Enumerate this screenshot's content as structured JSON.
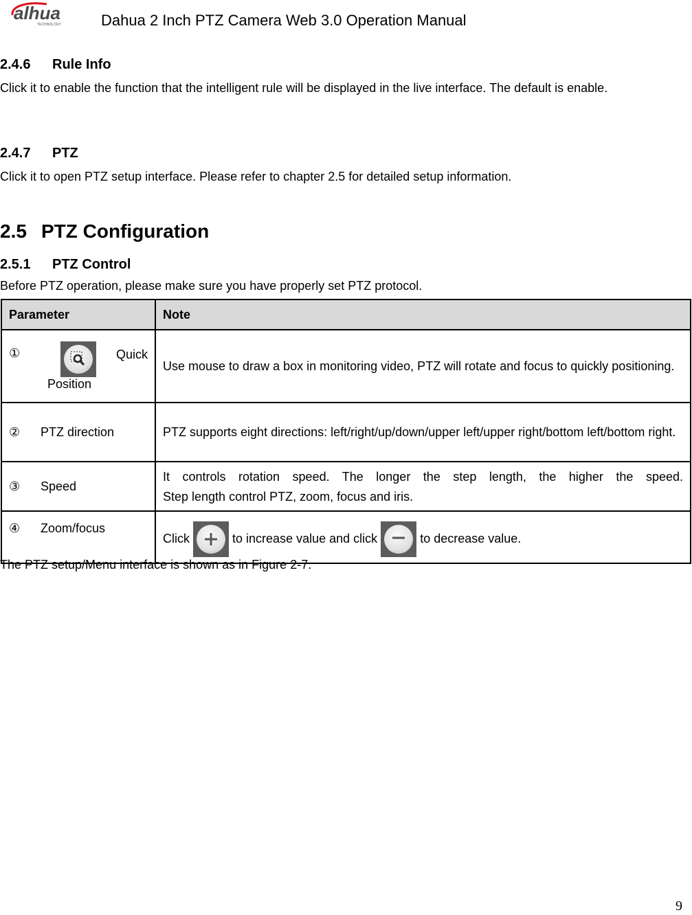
{
  "header": {
    "logo_text": "alhua",
    "logo_subtext": "TECHNOLOGY",
    "title": "Dahua 2 Inch PTZ Camera Web 3.0 Operation Manual"
  },
  "sections": {
    "s246": {
      "number": "2.4.6",
      "title": "Rule Info",
      "body": "Click it to enable the function that the intelligent rule will be displayed in the live interface. The default is enable."
    },
    "s247": {
      "number": "2.4.7",
      "title": "PTZ",
      "body": "Click it to open PTZ setup interface. Please refer to chapter 2.5 for detailed setup information."
    },
    "s25": {
      "number": "2.5",
      "title": "PTZ Configuration"
    },
    "s251": {
      "number": "2.5.1",
      "title": "PTZ Control",
      "body": "Before PTZ operation, please make sure you have properly set PTZ protocol."
    }
  },
  "table": {
    "headers": [
      "Parameter",
      "Note"
    ],
    "rows": [
      {
        "marker": "①",
        "icon": "quick-position-icon",
        "param_a": "Quick",
        "param_b": "Position",
        "note": "Use mouse to draw a box in monitoring video, PTZ will rotate and focus to quickly positioning."
      },
      {
        "marker": "②",
        "param": "PTZ direction",
        "note": "PTZ supports eight directions: left/right/up/down/upper left/upper right/bottom left/bottom right."
      },
      {
        "marker": "③",
        "param": "Speed",
        "note_line1": "It controls rotation speed. The longer the step length, the higher the speed.",
        "note_line2": "Step length control PTZ, zoom, focus and iris."
      },
      {
        "marker": "④",
        "param": "Zoom/focus",
        "note_a": "Click",
        "note_b": "to increase value and click",
        "note_c": "to decrease value."
      }
    ]
  },
  "after_table": "The PTZ setup/Menu interface is shown as in Figure 2-7.",
  "page_number": "9",
  "colors": {
    "logo_red": "#d7141a",
    "header_bg": "#d9d9d9",
    "icon_bg": "#5c5c5c"
  }
}
